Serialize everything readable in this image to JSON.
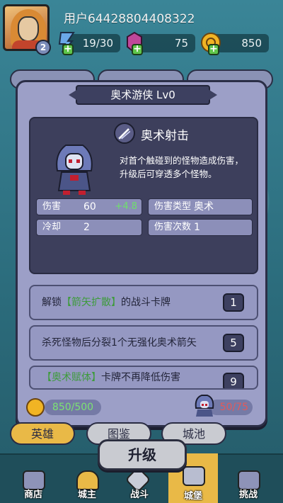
{
  "header": {
    "username": "用户64428804408322",
    "level": "2",
    "energy": "19/30",
    "gems": "75",
    "coins": "850"
  },
  "modal": {
    "title": "奥术游侠  Lv0",
    "skill_name": "奥术射击",
    "skill_desc": "对首个触碰到的怪物造成伤害，升级后可穿透多个怪物。",
    "stats": {
      "damage_label": "伤害",
      "damage_value": "60",
      "damage_bonus": "+4.8",
      "damage_type_label": "伤害类型",
      "damage_type_value": "奥术",
      "cooldown_label": "冷却",
      "cooldown_value": "2",
      "hits_label": "伤害次数",
      "hits_value": "1"
    },
    "cards": [
      {
        "prefix": "解锁",
        "highlight": "【箭矢扩散】",
        "suffix": "的战斗卡牌",
        "badge": "1"
      },
      {
        "prefix": "杀死怪物后分裂1个无强化奥术箭矢",
        "highlight": "",
        "suffix": "",
        "badge": "5"
      },
      {
        "prefix": "",
        "highlight": "【奥术赋体】",
        "suffix": "卡牌不再降低伤害",
        "badge": "9"
      }
    ],
    "cost_coins": "850/500",
    "cost_shards": "50/75"
  },
  "subtabs": [
    "英雄",
    "图鉴",
    "城池"
  ],
  "upgrade_label": "升级",
  "nav": [
    "商店",
    "城主",
    "战斗",
    "城堡",
    "挑战"
  ],
  "colors": {
    "accent_gold": "#e9b947",
    "green_text": "#6ee06a",
    "red_text": "#e25a5a",
    "panel_dark": "#3d3f5c"
  }
}
